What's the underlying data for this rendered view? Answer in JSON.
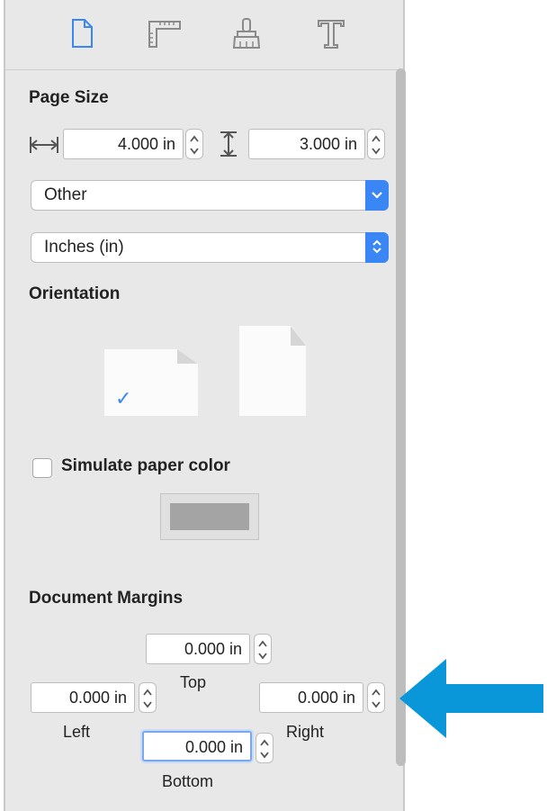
{
  "toolbar": {
    "tabs": [
      {
        "icon": "document-icon",
        "active": true
      },
      {
        "icon": "ruler-icon",
        "active": false
      },
      {
        "icon": "brush-icon",
        "active": false
      },
      {
        "icon": "text-icon",
        "active": false
      }
    ]
  },
  "page_size": {
    "heading": "Page Size",
    "width_value": "4.000 in",
    "height_value": "3.000 in",
    "preset_value": "Other",
    "units_value": "Inches (in)"
  },
  "orientation": {
    "heading": "Orientation",
    "selected": "landscape",
    "check_glyph": "✓"
  },
  "paper_color": {
    "label": "Simulate paper color",
    "checked": false,
    "swatch_color": "#a4a4a4"
  },
  "margins": {
    "heading": "Document Margins",
    "top": {
      "value": "0.000 in",
      "label": "Top"
    },
    "left": {
      "value": "0.000 in",
      "label": "Left"
    },
    "right": {
      "value": "0.000 in",
      "label": "Right"
    },
    "bottom": {
      "value": "0.000 in",
      "label": "Bottom"
    }
  },
  "colors": {
    "accent": "#3b86f5",
    "arrow": "#0a97d9"
  }
}
